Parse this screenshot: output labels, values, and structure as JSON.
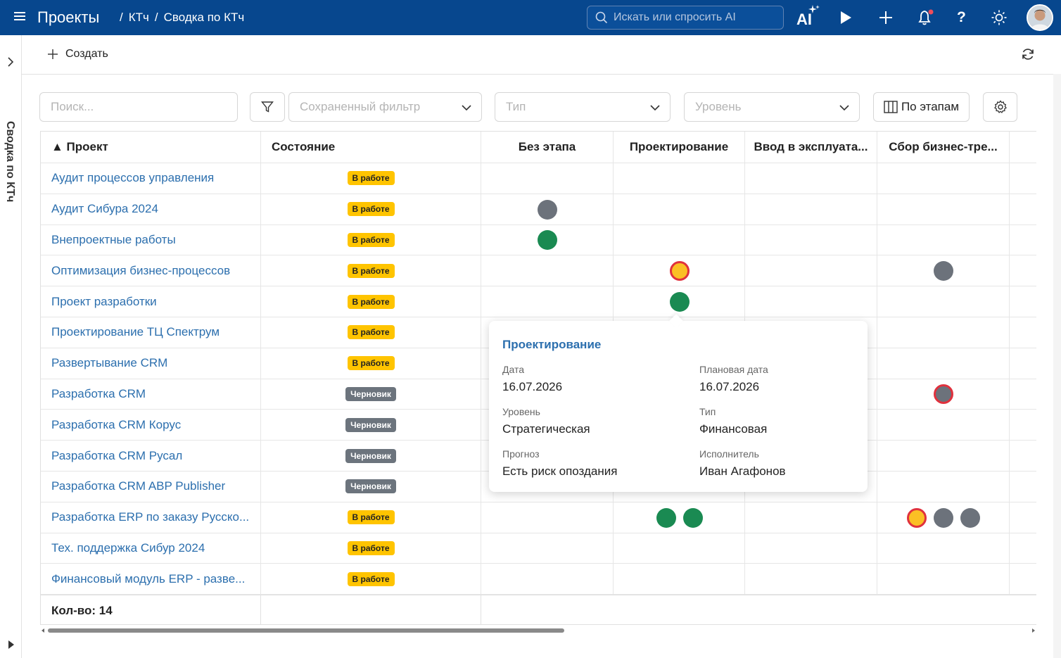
{
  "header": {
    "title": "Проекты",
    "breadcrumb": [
      "КТч",
      "Сводка по КТч"
    ],
    "search_placeholder": "Искать или спросить AI",
    "ai_label": "AI"
  },
  "side": {
    "title": "Сводка по КТч"
  },
  "toolbar": {
    "create_label": "Создать"
  },
  "filters": {
    "search_placeholder": "Поиск...",
    "saved_filter": "Сохраненный фильтр",
    "type": "Тип",
    "level": "Уровень",
    "stages_button": "По этапам"
  },
  "columns": {
    "project": "▲ Проект",
    "state": "Состояние",
    "stages": [
      "Без этапа",
      "Проектирование",
      "Ввод в эксплуата...",
      "Сбор бизнес-тре..."
    ]
  },
  "rows": [
    {
      "name": "Аудит процессов управления",
      "state": "В работе",
      "kind": "work",
      "dots": []
    },
    {
      "name": "Аудит Сибура 2024",
      "state": "В работе",
      "kind": "work",
      "dots": [
        {
          "c": 0,
          "s": "gray"
        }
      ]
    },
    {
      "name": "Внепроектные работы",
      "state": "В работе",
      "kind": "work",
      "dots": [
        {
          "c": 0,
          "s": "green"
        }
      ]
    },
    {
      "name": "Оптимизация бизнес-процессов",
      "state": "В работе",
      "kind": "work",
      "dots": [
        {
          "c": 1,
          "s": "warn"
        },
        {
          "c": 3,
          "s": "gray"
        }
      ]
    },
    {
      "name": "Проект разработки",
      "state": "В работе",
      "kind": "work",
      "dots": [
        {
          "c": 1,
          "s": "green"
        }
      ]
    },
    {
      "name": "Проектирование ТЦ Спектрум",
      "state": "В работе",
      "kind": "work",
      "dots": []
    },
    {
      "name": "Развертывание CRM",
      "state": "В работе",
      "kind": "work",
      "dots": []
    },
    {
      "name": "Разработка CRM",
      "state": "Черновик",
      "kind": "draft",
      "dots": [
        {
          "c": 3,
          "s": "redgray"
        }
      ]
    },
    {
      "name": "Разработка CRM Корус",
      "state": "Черновик",
      "kind": "draft",
      "dots": []
    },
    {
      "name": "Разработка CRM Русал",
      "state": "Черновик",
      "kind": "draft",
      "dots": []
    },
    {
      "name": "Разработка CRM ABP Publisher",
      "state": "Черновик",
      "kind": "draft",
      "dots": []
    },
    {
      "name": "Разработка ERP по заказу Русско...",
      "state": "В работе",
      "kind": "work",
      "dots": [
        {
          "c": 1,
          "s": "green"
        },
        {
          "c": 1,
          "s": "green"
        },
        {
          "c": 3,
          "s": "warn"
        },
        {
          "c": 3,
          "s": "gray"
        },
        {
          "c": 3,
          "s": "gray"
        }
      ]
    },
    {
      "name": "Тех. поддержка Сибур 2024",
      "state": "В работе",
      "kind": "work",
      "dots": []
    },
    {
      "name": "Финансовый модуль ERP - разве...",
      "state": "В работе",
      "kind": "work",
      "dots": []
    }
  ],
  "footer": {
    "count_label": "Кол-во: 14"
  },
  "tooltip": {
    "title": "Проектирование",
    "date_label": "Дата",
    "date": "16.07.2026",
    "plan_label": "Плановая дата",
    "plan": "16.07.2026",
    "level_label": "Уровень",
    "level": "Стратегическая",
    "type_label": "Тип",
    "type": "Финансовая",
    "forecast_label": "Прогноз",
    "forecast": "Есть риск опоздания",
    "owner_label": "Исполнитель",
    "owner": "Иван Агафонов"
  },
  "colors": {
    "header_bg": "#07478e",
    "link": "#2c6fae",
    "work_badge": "#ffc400",
    "draft_badge": "#6c747d",
    "dot_green": "#1a8a52",
    "dot_gray": "#6c727b",
    "dot_warn": "#fbbf24",
    "dot_border_red": "#e0313d"
  }
}
